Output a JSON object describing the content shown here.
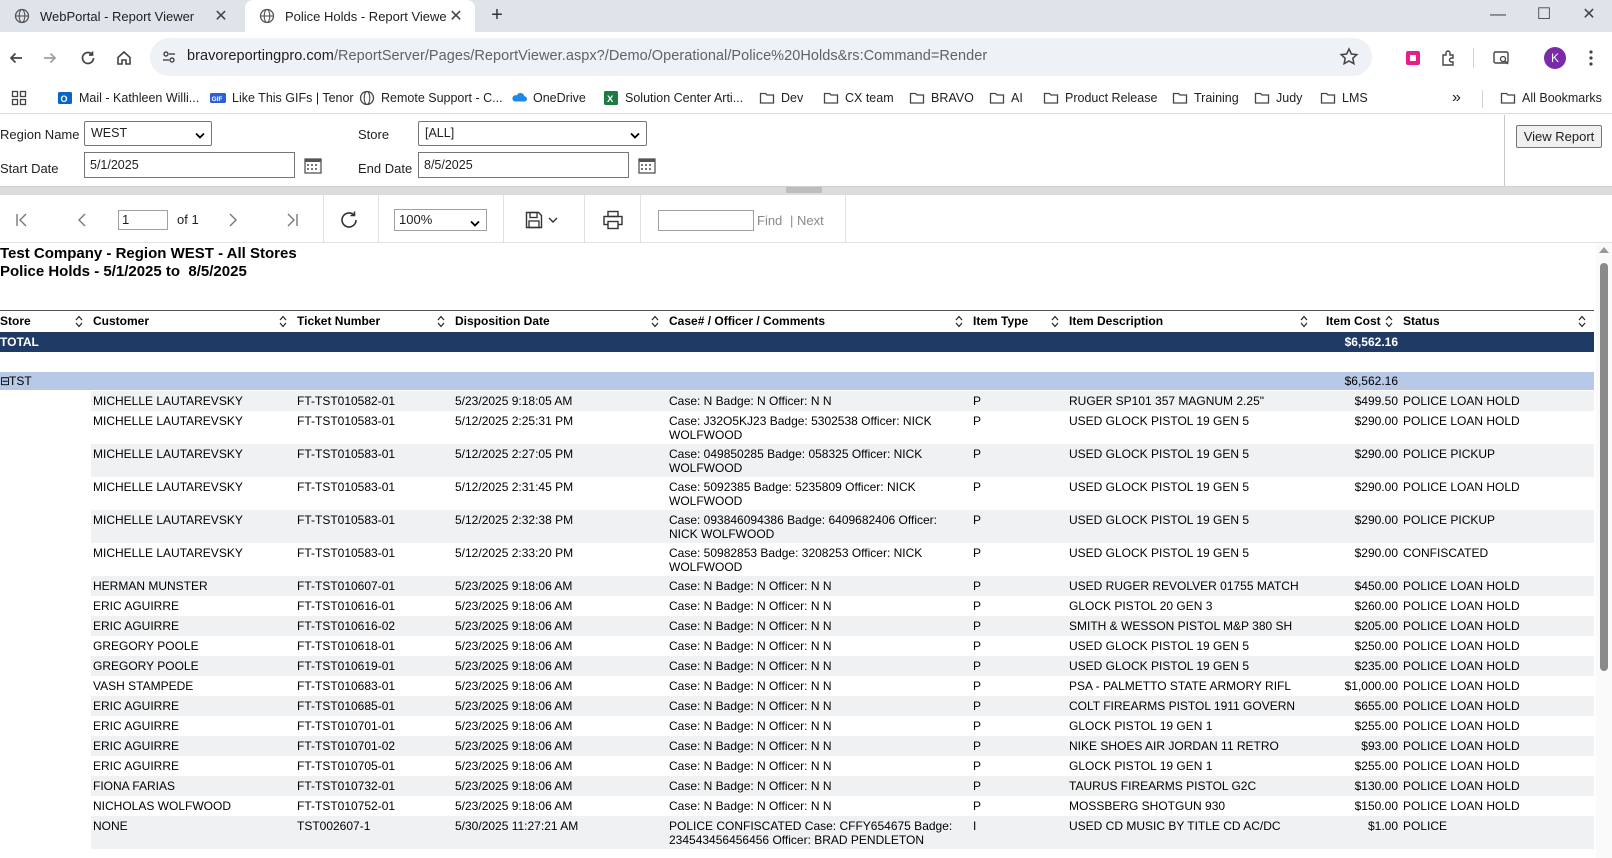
{
  "browser": {
    "tabs": [
      {
        "title": "WebPortal - Report Viewer",
        "active": false
      },
      {
        "title": "Police Holds - Report Viewer",
        "active": true
      }
    ],
    "url_host": "bravoreportingpro.com",
    "url_path": "/ReportServer/Pages/ReportViewer.aspx?/Demo/Operational/Police%20Holds&rs:Command=Render",
    "avatar_letter": "K",
    "bookmarks": [
      {
        "label": "Mail - Kathleen Willi...",
        "icon": "outlook-icon"
      },
      {
        "label": "Like This GIFs | Tenor",
        "icon": "gif-icon"
      },
      {
        "label": "Remote Support - C...",
        "icon": "globe-icon"
      },
      {
        "label": "OneDrive",
        "icon": "onedrive-icon"
      },
      {
        "label": "Solution Center Arti...",
        "icon": "excel-icon"
      },
      {
        "label": "Dev",
        "icon": "folder-icon"
      },
      {
        "label": "CX team",
        "icon": "folder-icon"
      },
      {
        "label": "BRAVO",
        "icon": "folder-icon"
      },
      {
        "label": "AI",
        "icon": "folder-icon"
      },
      {
        "label": "Product Release",
        "icon": "folder-icon"
      },
      {
        "label": "Training",
        "icon": "folder-icon"
      },
      {
        "label": "Judy",
        "icon": "folder-icon"
      },
      {
        "label": "LMS",
        "icon": "folder-icon"
      }
    ],
    "more_bookmarks": "»",
    "all_bookmarks": "All Bookmarks"
  },
  "params": {
    "region_label": "Region Name",
    "region_value": "WEST",
    "store_label": "Store",
    "store_value": "[ALL]",
    "start_label": "Start Date",
    "start_value": "5/1/2025",
    "end_label": "End Date",
    "end_value": "8/5/2025",
    "view_report": "View Report"
  },
  "viewer_toolbar": {
    "page_value": "1",
    "of_label": "of 1",
    "zoom": "100%",
    "find": "Find",
    "separator": "|",
    "next": "Next"
  },
  "report": {
    "title_line1": "Test Company - Region WEST - All Stores",
    "title_line2": "Police Holds - 5/1/2025 to  8/5/2025",
    "columns": [
      "Store",
      "Customer",
      "Ticket Number",
      "Disposition Date",
      "Case# / Officer / Comments",
      "Item Type",
      "Item Description",
      "Item Cost",
      "Status"
    ],
    "total_label": "TOTAL",
    "total_cost": "$6,562.16",
    "group_toggle": "⊟",
    "group_label": "TST",
    "group_cost": "$6,562.16",
    "rows": [
      {
        "customer": "MICHELLE LAUTAREVSKY",
        "ticket": "FT-TST010582-01",
        "date": "5/23/2025 9:18:05 AM",
        "comments": "Case: N Badge: N Officer: N N",
        "type": "P",
        "desc": "RUGER SP101 357 MAGNUM 2.25\"",
        "cost": "$499.50",
        "status": "POLICE LOAN HOLD"
      },
      {
        "customer": "MICHELLE LAUTAREVSKY",
        "ticket": "FT-TST010583-01",
        "date": "5/12/2025 2:25:31 PM",
        "comments": "Case: J32O5KJ23 Badge: 5302538 Officer: NICK WOLFWOOD",
        "type": "P",
        "desc": "USED GLOCK PISTOL 19 GEN 5",
        "cost": "$290.00",
        "status": "POLICE LOAN HOLD"
      },
      {
        "customer": "MICHELLE LAUTAREVSKY",
        "ticket": "FT-TST010583-01",
        "date": "5/12/2025 2:27:05 PM",
        "comments": "Case: 049850285 Badge: 058325 Officer: NICK WOLFWOOD",
        "type": "P",
        "desc": "USED GLOCK PISTOL 19 GEN 5",
        "cost": "$290.00",
        "status": "POLICE PICKUP"
      },
      {
        "customer": "MICHELLE LAUTAREVSKY",
        "ticket": "FT-TST010583-01",
        "date": "5/12/2025 2:31:45 PM",
        "comments": "Case: 5092385 Badge: 5235809 Officer: NICK WOLFWOOD",
        "type": "P",
        "desc": "USED GLOCK PISTOL 19 GEN 5",
        "cost": "$290.00",
        "status": "POLICE LOAN HOLD"
      },
      {
        "customer": "MICHELLE LAUTAREVSKY",
        "ticket": "FT-TST010583-01",
        "date": "5/12/2025 2:32:38 PM",
        "comments": "Case: 093846094386 Badge: 6409682406 Officer: NICK WOLFWOOD",
        "type": "P",
        "desc": "USED GLOCK PISTOL 19 GEN 5",
        "cost": "$290.00",
        "status": "POLICE PICKUP"
      },
      {
        "customer": "MICHELLE LAUTAREVSKY",
        "ticket": "FT-TST010583-01",
        "date": "5/12/2025 2:33:20 PM",
        "comments": "Case: 50982853 Badge: 3208253 Officer: NICK WOLFWOOD",
        "type": "P",
        "desc": "USED GLOCK PISTOL 19 GEN 5",
        "cost": "$290.00",
        "status": "CONFISCATED"
      },
      {
        "customer": "HERMAN MUNSTER",
        "ticket": "FT-TST010607-01",
        "date": "5/23/2025 9:18:06 AM",
        "comments": "Case: N Badge: N Officer: N N",
        "type": "P",
        "desc": "USED RUGER REVOLVER 01755 MATCH",
        "cost": "$450.00",
        "status": "POLICE LOAN HOLD"
      },
      {
        "customer": "ERIC AGUIRRE",
        "ticket": "FT-TST010616-01",
        "date": "5/23/2025 9:18:06 AM",
        "comments": "Case: N Badge: N Officer: N N",
        "type": "P",
        "desc": "GLOCK PISTOL 20 GEN 3",
        "cost": "$260.00",
        "status": "POLICE LOAN HOLD"
      },
      {
        "customer": "ERIC AGUIRRE",
        "ticket": "FT-TST010616-02",
        "date": "5/23/2025 9:18:06 AM",
        "comments": "Case: N Badge: N Officer: N N",
        "type": "P",
        "desc": "SMITH & WESSON PISTOL M&P 380 SH",
        "cost": "$205.00",
        "status": "POLICE LOAN HOLD"
      },
      {
        "customer": "GREGORY POOLE",
        "ticket": "FT-TST010618-01",
        "date": "5/23/2025 9:18:06 AM",
        "comments": "Case: N Badge: N Officer: N N",
        "type": "P",
        "desc": "USED GLOCK PISTOL 19 GEN 5",
        "cost": "$250.00",
        "status": "POLICE LOAN HOLD"
      },
      {
        "customer": "GREGORY POOLE",
        "ticket": "FT-TST010619-01",
        "date": "5/23/2025 9:18:06 AM",
        "comments": "Case: N Badge: N Officer: N N",
        "type": "P",
        "desc": "USED GLOCK PISTOL 19 GEN 5",
        "cost": "$235.00",
        "status": "POLICE LOAN HOLD"
      },
      {
        "customer": "VASH STAMPEDE",
        "ticket": "FT-TST010683-01",
        "date": "5/23/2025 9:18:06 AM",
        "comments": "Case: N Badge: N Officer: N N",
        "type": "P",
        "desc": "PSA - PALMETTO STATE ARMORY RIFL",
        "cost": "$1,000.00",
        "status": "POLICE LOAN HOLD"
      },
      {
        "customer": "ERIC AGUIRRE",
        "ticket": "FT-TST010685-01",
        "date": "5/23/2025 9:18:06 AM",
        "comments": "Case: N Badge: N Officer: N N",
        "type": "P",
        "desc": "COLT FIREARMS PISTOL 1911 GOVERN",
        "cost": "$655.00",
        "status": "POLICE LOAN HOLD"
      },
      {
        "customer": "ERIC AGUIRRE",
        "ticket": "FT-TST010701-01",
        "date": "5/23/2025 9:18:06 AM",
        "comments": "Case: N Badge: N Officer: N N",
        "type": "P",
        "desc": "GLOCK PISTOL 19 GEN 1",
        "cost": "$255.00",
        "status": "POLICE LOAN HOLD"
      },
      {
        "customer": "ERIC AGUIRRE",
        "ticket": "FT-TST010701-02",
        "date": "5/23/2025 9:18:06 AM",
        "comments": "Case: N Badge: N Officer: N N",
        "type": "P",
        "desc": "NIKE SHOES AIR JORDAN 11 RETRO",
        "cost": "$93.00",
        "status": "POLICE LOAN HOLD"
      },
      {
        "customer": "ERIC AGUIRRE",
        "ticket": "FT-TST010705-01",
        "date": "5/23/2025 9:18:06 AM",
        "comments": "Case: N Badge: N Officer: N N",
        "type": "P",
        "desc": "GLOCK PISTOL 19 GEN 1",
        "cost": "$255.00",
        "status": "POLICE LOAN HOLD"
      },
      {
        "customer": "FIONA FARIAS",
        "ticket": "FT-TST010732-01",
        "date": "5/23/2025 9:18:06 AM",
        "comments": "Case: N Badge: N Officer: N N",
        "type": "P",
        "desc": "TAURUS FIREARMS PISTOL G2C",
        "cost": "$130.00",
        "status": "POLICE LOAN HOLD"
      },
      {
        "customer": "NICHOLAS WOLFWOOD",
        "ticket": "FT-TST010752-01",
        "date": "5/23/2025 9:18:06 AM",
        "comments": "Case: N Badge: N Officer: N N",
        "type": "P",
        "desc": "MOSSBERG SHOTGUN 930",
        "cost": "$150.00",
        "status": "POLICE LOAN HOLD"
      },
      {
        "customer": "NONE",
        "ticket": "TST002607-1",
        "date": "5/30/2025 11:27:21 AM",
        "comments": "POLICE CONFISCATED Case: CFFY654675 Badge: 234543456456456 Officer: BRAD PENDLETON",
        "type": "I",
        "desc": "USED CD MUSIC BY TITLE CD AC/DC",
        "cost": "$1.00",
        "status": "POLICE"
      }
    ]
  },
  "colors": {
    "total_row_bg": "#1f3a64",
    "group_row_bg": "#b7c9e6",
    "alt_row_bg": "#f0f1f3",
    "tabstrip_bg": "#dfe3ea"
  }
}
